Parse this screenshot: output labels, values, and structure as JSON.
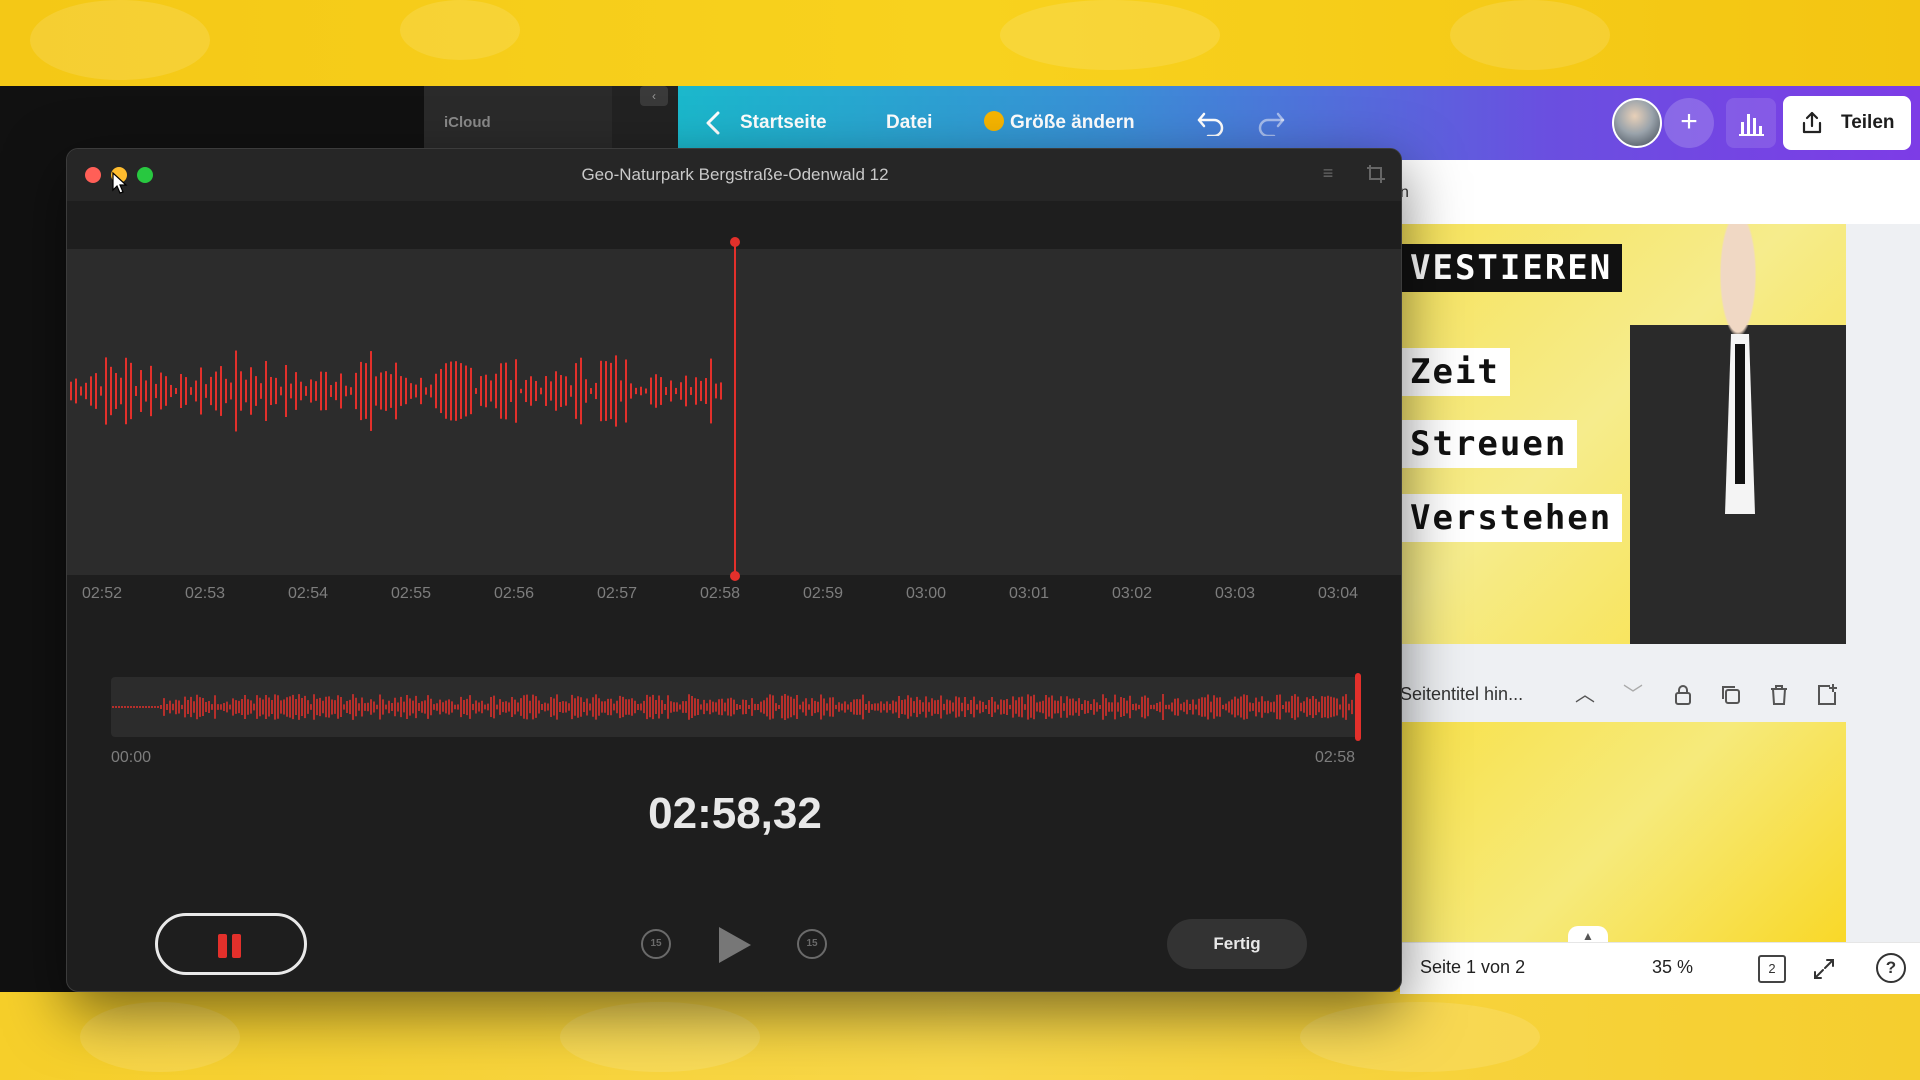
{
  "voice_memo": {
    "title": "Geo-Naturpark Bergstraße-Odenwald 12",
    "timeline_ticks": [
      "02:52",
      "02:53",
      "02:54",
      "02:55",
      "02:56",
      "02:57",
      "02:58",
      "02:59",
      "03:00",
      "03:01",
      "03:02",
      "03:03",
      "03:04"
    ],
    "overview_start": "00:00",
    "overview_end": "02:58",
    "timer": "02:58,32",
    "skip_back_label": "15",
    "skip_forward_label": "15",
    "done_label": "Fertig",
    "accent_color": "#e3302b"
  },
  "finder": {
    "sidebar_label": "iCloud"
  },
  "canva": {
    "nav": {
      "home": "Startseite",
      "file": "Datei",
      "resize": "Größe ändern",
      "share": "Teilen"
    },
    "thumbnail_words": [
      "VESTIEREN",
      "Zeit",
      "Streuen",
      "Verstehen"
    ],
    "page_title_placeholder": "Seitentitel hin...",
    "page_indicator": "Seite 1 von 2",
    "zoom": "35 %",
    "page_count": "2",
    "help": "?"
  },
  "icons": [
    "back-chevron-icon",
    "crown-icon",
    "undo-icon",
    "redo-icon",
    "plus-icon",
    "insights-icon",
    "share-icon",
    "lock-icon",
    "duplicate-icon",
    "trash-icon",
    "add-page-icon",
    "grid-icon",
    "fullscreen-icon",
    "help-icon",
    "pause-icon",
    "play-icon",
    "skip-back-15-icon",
    "skip-forward-15-icon"
  ]
}
